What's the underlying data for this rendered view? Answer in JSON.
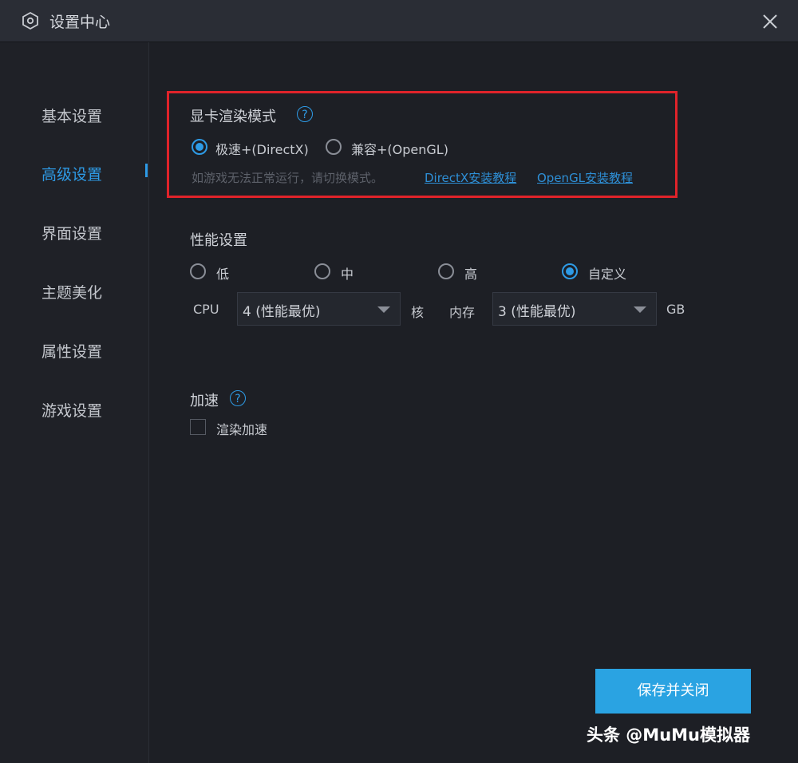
{
  "window": {
    "title": "设置中心"
  },
  "sidebar": {
    "items": [
      {
        "label": "基本设置",
        "active": false
      },
      {
        "label": "高级设置",
        "active": true
      },
      {
        "label": "界面设置",
        "active": false
      },
      {
        "label": "主题美化",
        "active": false
      },
      {
        "label": "属性设置",
        "active": false
      },
      {
        "label": "游戏设置",
        "active": false
      }
    ]
  },
  "render_mode": {
    "title": "显卡渲染模式",
    "help": "?",
    "options": [
      {
        "label": "极速+(DirectX)",
        "checked": true
      },
      {
        "label": "兼容+(OpenGL)",
        "checked": false
      }
    ],
    "hint": "如游戏无法正常运行，请切换模式。",
    "links": [
      "DirectX安装教程",
      "OpenGL安装教程"
    ]
  },
  "performance": {
    "title": "性能设置",
    "options": [
      {
        "label": "低",
        "checked": false
      },
      {
        "label": "中",
        "checked": false
      },
      {
        "label": "高",
        "checked": false
      },
      {
        "label": "自定义",
        "checked": true
      }
    ],
    "cpu_label": "CPU",
    "cpu_value": "4 (性能最优)",
    "cpu_unit": "核",
    "mem_label": "内存",
    "mem_value": "3 (性能最优)",
    "mem_unit": "GB"
  },
  "acceleration": {
    "title": "加速",
    "help": "?",
    "checkbox_label": "渲染加速",
    "checked": false
  },
  "footer": {
    "save_label": "保存并关闭"
  },
  "watermark": "头条 @MuMu模拟器",
  "colors": {
    "accent": "#2e9be6",
    "highlight_box": "#e0232a",
    "button": "#2aa3e2"
  }
}
